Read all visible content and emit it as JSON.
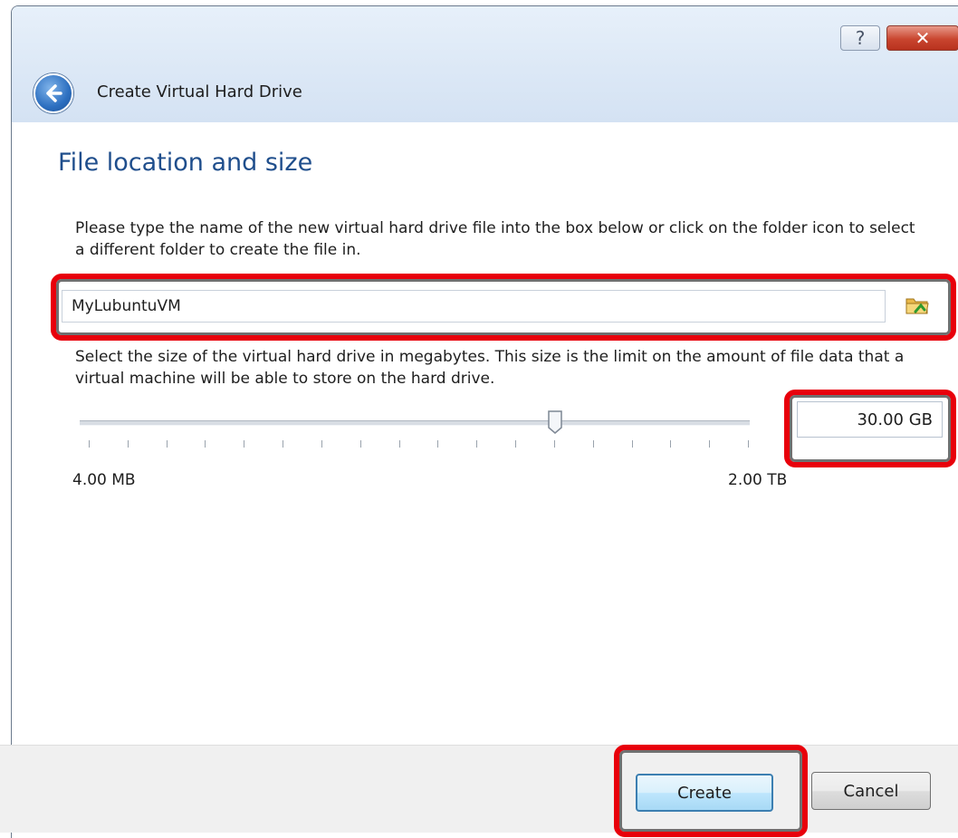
{
  "window": {
    "title": "Create Virtual Hard Drive",
    "help_label": "?",
    "close_label": "✕"
  },
  "page": {
    "heading": "File location and size",
    "location_description": "Please type the name of the new virtual hard drive file into the box below or click on the folder icon to select a different folder to create the file in.",
    "size_description": "Select the size of the virtual hard drive in megabytes. This size is the limit on the amount of file data that a virtual machine will be able to store on the hard drive."
  },
  "file": {
    "name": "MyLubuntuVM",
    "folder_icon": "folder-icon"
  },
  "size": {
    "value": "30.00 GB",
    "slider_fraction": 0.71,
    "min_label": "4.00 MB",
    "max_label": "2.00 TB"
  },
  "buttons": {
    "create": "Create",
    "cancel": "Cancel"
  },
  "colors": {
    "heading": "#1f4e8c",
    "highlight": "#e8000b",
    "close_button": "#c9452f"
  }
}
